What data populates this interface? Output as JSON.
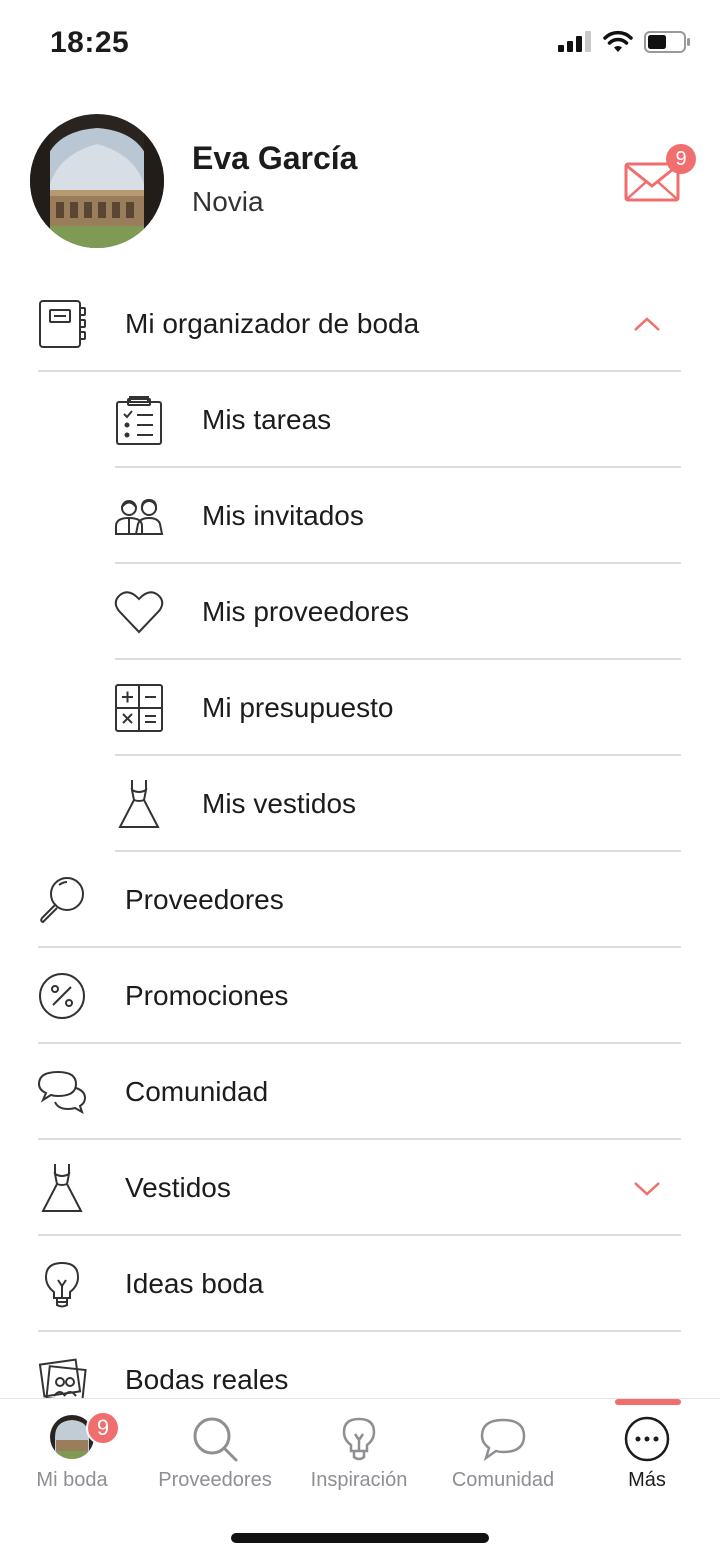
{
  "status_bar": {
    "time": "18:25"
  },
  "profile": {
    "name": "Eva García",
    "role": "Novia",
    "inbox_count": "9"
  },
  "menu": {
    "organizer": "Mi organizador de boda",
    "sub_items": [
      "Mis tareas",
      "Mis invitados",
      "Mis proveedores",
      "Mi presupuesto",
      "Mis vestidos"
    ],
    "items": [
      "Proveedores",
      "Promociones",
      "Comunidad",
      "Vestidos",
      "Ideas boda",
      "Bodas reales"
    ]
  },
  "tabbar": {
    "tabs": [
      "Mi boda",
      "Proveedores",
      "Inspiración",
      "Comunidad",
      "Más"
    ],
    "mi_boda_badge": "9"
  },
  "colors": {
    "accent": "#f06e6e",
    "text": "#1c1c1e",
    "muted": "#8e8e93",
    "divider": "#dcdcdc"
  }
}
